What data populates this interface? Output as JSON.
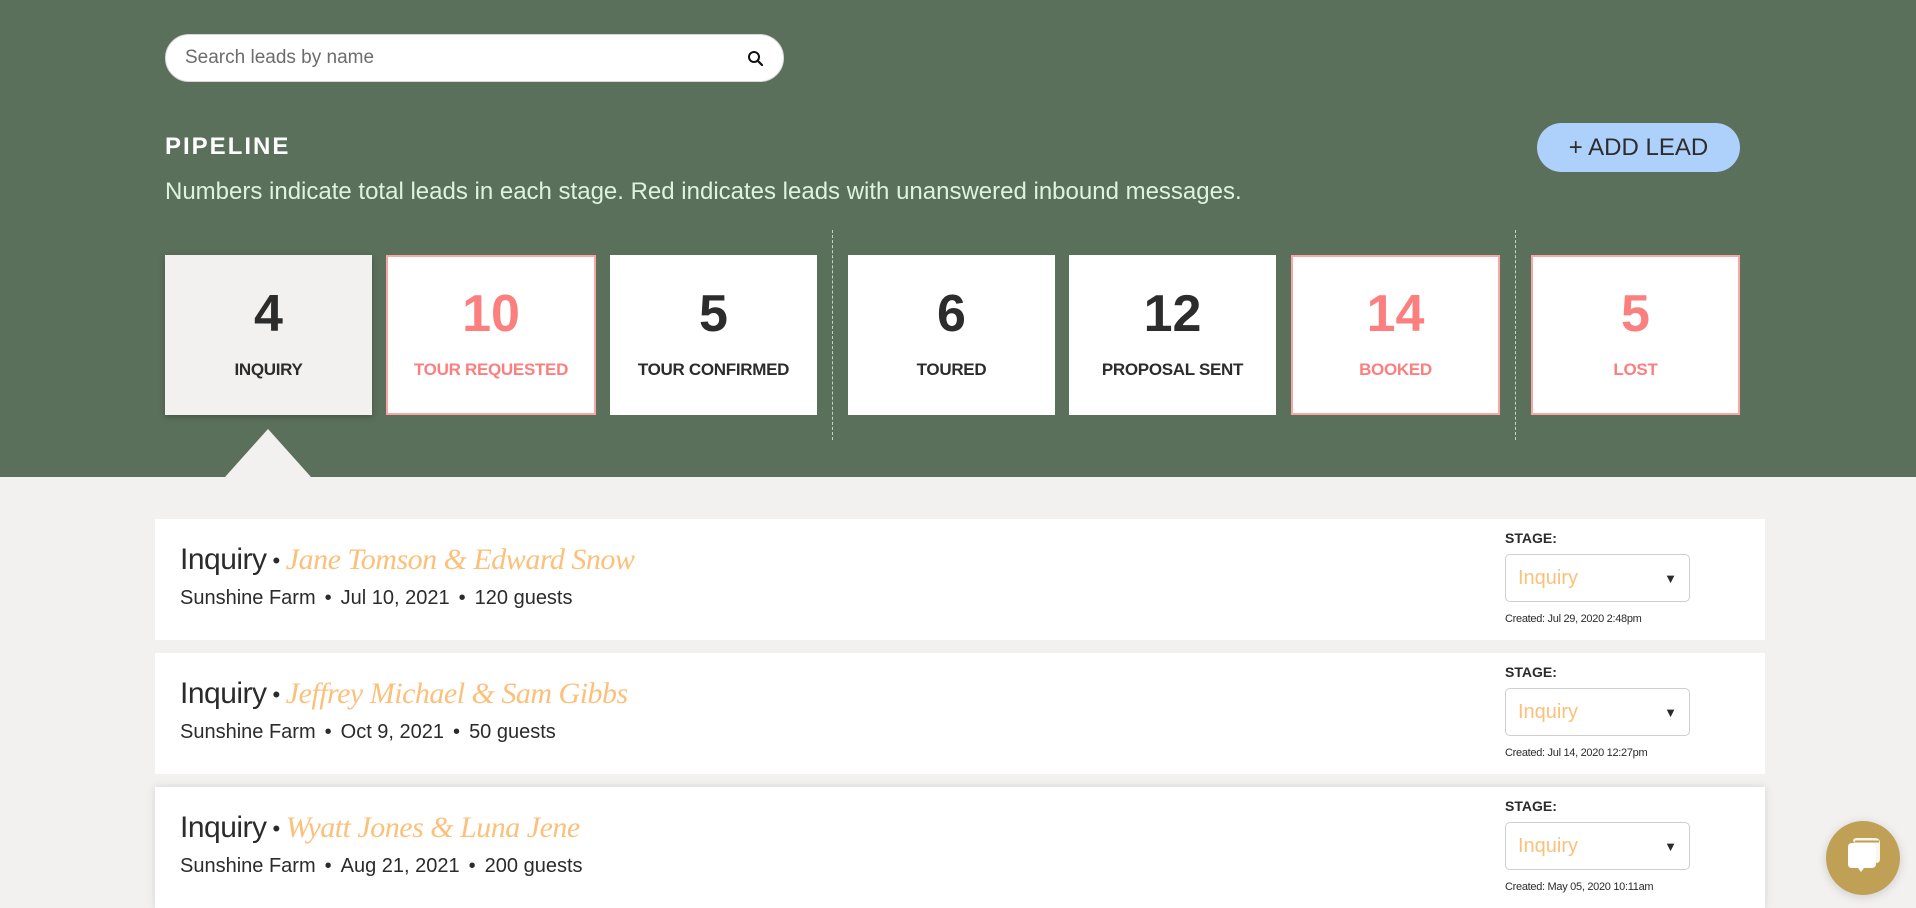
{
  "search": {
    "placeholder": "Search leads by name",
    "value": "",
    "icon": "search-icon"
  },
  "pipeline": {
    "title": "PIPELINE",
    "description": "Numbers indicate total leads in each stage. Red indicates leads with unanswered inbound messages.",
    "add_lead_label": "+ ADD LEAD",
    "stages": [
      {
        "count": "4",
        "label": "INQUIRY",
        "state": "active"
      },
      {
        "count": "10",
        "label": "TOUR REQUESTED",
        "state": "alert"
      },
      {
        "count": "5",
        "label": "TOUR CONFIRMED",
        "state": "normal"
      },
      {
        "count": "6",
        "label": "TOURED",
        "state": "normal"
      },
      {
        "count": "12",
        "label": "PROPOSAL SENT",
        "state": "normal"
      },
      {
        "count": "14",
        "label": "BOOKED",
        "state": "alert"
      },
      {
        "count": "5",
        "label": "LOST",
        "state": "alert"
      }
    ],
    "colors": {
      "header_bg": "#5b705b",
      "alert": "#fb7f7e",
      "alert_border": "#fca5a5",
      "add_lead_bg": "#aed1fc"
    }
  },
  "leads": [
    {
      "stage": "Inquiry",
      "separator": "•",
      "names": "Jane Tomson & Edward Snow",
      "venue": "Sunshine Farm",
      "event_date": "Jul 10, 2021",
      "guests": "120 guests",
      "stage_label": "STAGE:",
      "stage_value": "Inquiry",
      "created": "Created: Jul 29, 2020 2:48pm"
    },
    {
      "stage": "Inquiry",
      "separator": "•",
      "names": "Jeffrey Michael & Sam Gibbs",
      "venue": "Sunshine Farm",
      "event_date": "Oct 9, 2021",
      "guests": "50 guests",
      "stage_label": "STAGE:",
      "stage_value": "Inquiry",
      "created": "Created: Jul 14, 2020 12:27pm"
    },
    {
      "stage": "Inquiry",
      "separator": "•",
      "names": "Wyatt Jones & Luna Jene",
      "venue": "Sunshine Farm",
      "event_date": "Aug 21, 2021",
      "guests": "200 guests",
      "stage_label": "STAGE:",
      "stage_value": "Inquiry",
      "created": "Created: May 05, 2020 10:11am"
    }
  ],
  "meta_dot": "•",
  "caret": "▼",
  "chat": {
    "icon": "chat-bubbles-icon",
    "color": "#c0a055"
  }
}
